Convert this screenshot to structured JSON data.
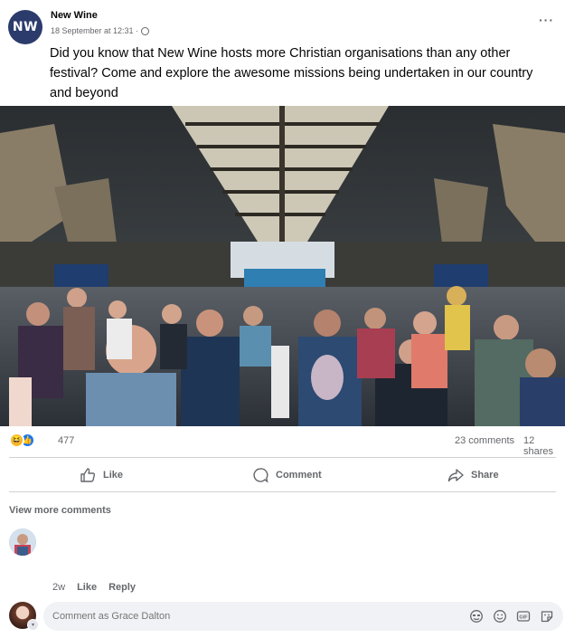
{
  "post": {
    "avatar_initials": "NW",
    "page_name": "New Wine",
    "timestamp": "18 September at 12:31 ·",
    "more_icon": "···",
    "text": "Did you know that New Wine hosts more Christian organisations than any other festival? Come and explore the awesome missions being undertaken in our country and beyond"
  },
  "stats": {
    "reaction_count": "477",
    "comments": "23 comments",
    "shares": "12 shares"
  },
  "actions": {
    "like": "Like",
    "comment": "Comment",
    "share": "Share"
  },
  "comments_section": {
    "view_more": "View more comments",
    "comment_time": "2w",
    "comment_like": "Like",
    "comment_reply": "Reply",
    "input_placeholder": "Comment as Grace Dalton"
  },
  "colors": {
    "brand_avatar": "#2b3b6b",
    "meta_gray": "#65676b",
    "like_blue": "#1877f2",
    "input_bg": "#f0f2f5"
  },
  "icons": [
    "globe-icon",
    "more-icon",
    "like-icon",
    "comment-icon",
    "share-icon",
    "sticker-icon",
    "emoji-icon",
    "gif-icon",
    "photo-sticker-icon"
  ]
}
